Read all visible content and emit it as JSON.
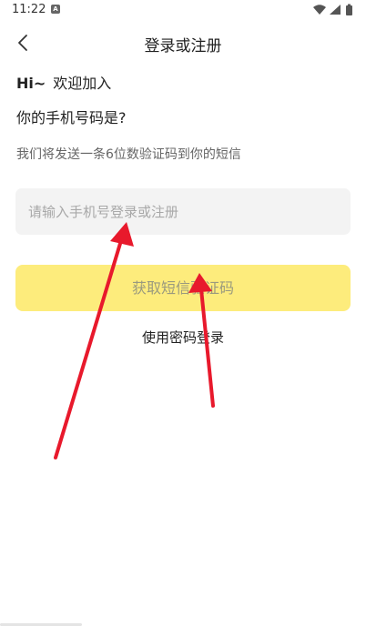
{
  "status_bar": {
    "time": "11:22",
    "notification_glyph": "A",
    "icons": [
      "wifi-icon",
      "signal-icon",
      "battery-icon"
    ]
  },
  "nav": {
    "back_icon": "chevron-left-icon",
    "title": "登录或注册"
  },
  "content": {
    "greeting_hi": "Hi~",
    "greeting_text": "欢迎加入",
    "question": "你的手机号码是?",
    "sub_text": "我们将发送一条6位数验证码到你的短信"
  },
  "form": {
    "phone_placeholder": "请输入手机号登录或注册",
    "phone_value": "",
    "get_code_label": "获取短信验证码",
    "password_login_label": "使用密码登录"
  },
  "colors": {
    "button_bg": "#fdec7c",
    "input_bg": "#f3f3f3",
    "annotation_arrow": "#e8192c"
  }
}
